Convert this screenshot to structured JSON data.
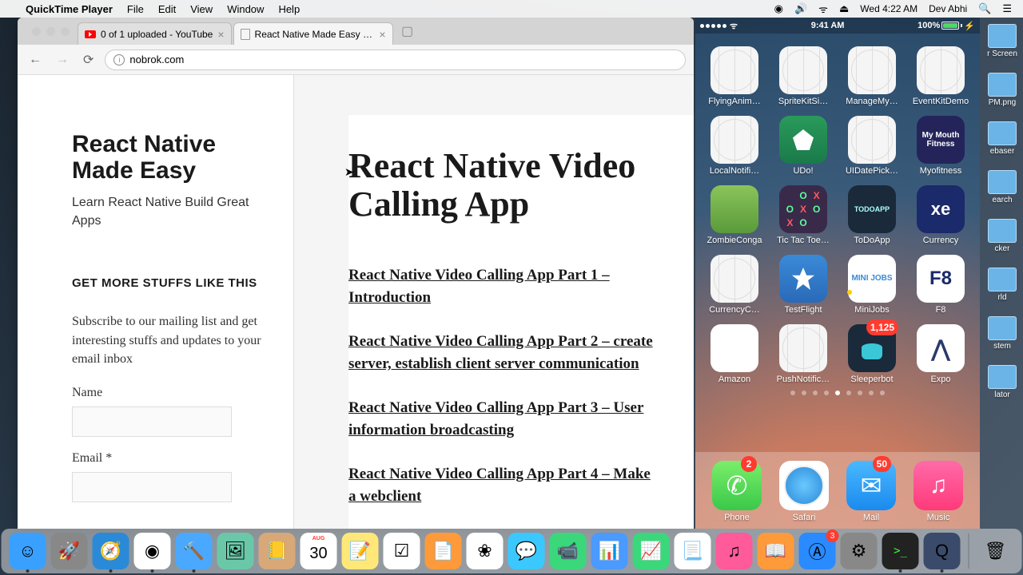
{
  "menubar": {
    "app_name": "QuickTime Player",
    "menus": [
      "File",
      "Edit",
      "View",
      "Window",
      "Help"
    ],
    "clock": "Wed 4:22 AM",
    "user": "Dev Abhi"
  },
  "browser": {
    "tabs": [
      {
        "title": "0 of 1 uploaded - YouTube",
        "active": false
      },
      {
        "title": "React Native Made Easy – Lea",
        "active": true
      }
    ],
    "url": "nobrok.com"
  },
  "page": {
    "site_title": "React Native Made Easy",
    "tagline": "Learn React Native Build Great Apps",
    "widget_title": "GET MORE STUFFS LIKE THIS",
    "widget_text": "Subscribe to our mailing list and get interesting stuffs and updates to your email inbox",
    "name_label": "Name",
    "email_label": "Email *",
    "article_title": "React Native Video Calling App",
    "links": [
      "React Native Video Calling App Part 1 – Introduction",
      "React Native Video Calling App Part 2 – create server, establish client server communication",
      "React Native Video Calling App Part 3 – User information broadcasting",
      "React Native Video Calling App Part 4 – Make a webclient"
    ]
  },
  "phone": {
    "time": "9:41 AM",
    "battery": "100%",
    "apps_rows": [
      [
        {
          "label": "FlyingAnim…",
          "style": "placeholder"
        },
        {
          "label": "SpriteKitSi…",
          "style": "placeholder"
        },
        {
          "label": "ManageMy…",
          "style": "placeholder"
        },
        {
          "label": "EventKitDemo",
          "style": "placeholder"
        }
      ],
      [
        {
          "label": "LocalNotifi…",
          "style": "placeholder"
        },
        {
          "label": "UDo!",
          "style": "ic-udo"
        },
        {
          "label": "UIDatePick…",
          "style": "placeholder"
        },
        {
          "label": "Myofitness",
          "style": "ic-myfit",
          "text": "My Mouth Fitness"
        }
      ],
      [
        {
          "label": "ZombieConga",
          "style": "ic-zombie"
        },
        {
          "label": "Tic Tac Toe…",
          "style": "ic-ttt"
        },
        {
          "label": "ToDoApp",
          "style": "ic-todo",
          "text": "TODOAPP"
        },
        {
          "label": "Currency",
          "style": "ic-xe",
          "text": "xe"
        }
      ],
      [
        {
          "label": "CurrencyC…",
          "style": "placeholder"
        },
        {
          "label": "TestFlight",
          "style": "ic-tf"
        },
        {
          "label": "MiniJobs",
          "style": "ic-mj",
          "text": "MINI JOBS",
          "dot": true
        },
        {
          "label": "F8",
          "style": "ic-f8",
          "text": "F8"
        }
      ],
      [
        {
          "label": "Amazon",
          "style": "ic-amz"
        },
        {
          "label": "PushNotific…",
          "style": "placeholder"
        },
        {
          "label": "Sleeperbot",
          "style": "ic-sleep",
          "badge": "1,125"
        },
        {
          "label": "Expo",
          "style": "ic-expo",
          "text": "⋀"
        }
      ]
    ],
    "dock": [
      {
        "label": "Phone",
        "style": "ic-phone",
        "glyph": "✆",
        "badge": "2"
      },
      {
        "label": "Safari",
        "style": "ic-safari"
      },
      {
        "label": "Mail",
        "style": "ic-mail",
        "glyph": "✉",
        "badge": "50"
      },
      {
        "label": "Music",
        "style": "ic-music",
        "glyph": "♫"
      }
    ]
  },
  "desktop_icons": [
    "r Screen",
    "PM.png",
    "ebaser",
    "earch",
    "cker",
    "rld",
    "stem",
    "lator"
  ],
  "dock": {
    "items": [
      {
        "name": "finder",
        "bg": "#3aa0ff",
        "glyph": "☺",
        "running": true
      },
      {
        "name": "launchpad",
        "bg": "#888",
        "glyph": "🚀"
      },
      {
        "name": "safari",
        "bg": "#2a8ad8",
        "glyph": "🧭",
        "running": true
      },
      {
        "name": "chrome",
        "bg": "#fff",
        "glyph": "◉",
        "running": true
      },
      {
        "name": "xcode",
        "bg": "#4aa8ff",
        "glyph": "🔨",
        "running": true
      },
      {
        "name": "preview",
        "bg": "#6ac8a8",
        "glyph": "🖼"
      },
      {
        "name": "contacts",
        "bg": "#d8a878",
        "glyph": "📒"
      },
      {
        "name": "calendar",
        "bg": "#fff",
        "glyph": "30",
        "text": "AUG",
        "running": false
      },
      {
        "name": "notes",
        "bg": "#ffe878",
        "glyph": "📝"
      },
      {
        "name": "reminders",
        "bg": "#fff",
        "glyph": "☑"
      },
      {
        "name": "pages",
        "bg": "#ff9a3a",
        "glyph": "📄"
      },
      {
        "name": "photos",
        "bg": "#fff",
        "glyph": "❀"
      },
      {
        "name": "messages",
        "bg": "#3ac8ff",
        "glyph": "💬"
      },
      {
        "name": "facetime",
        "bg": "#3ad87a",
        "glyph": "📹"
      },
      {
        "name": "keynote",
        "bg": "#4a9aff",
        "glyph": "📊"
      },
      {
        "name": "numbers",
        "bg": "#3ad87a",
        "glyph": "📈"
      },
      {
        "name": "textedit",
        "bg": "#fff",
        "glyph": "📃"
      },
      {
        "name": "itunes",
        "bg": "#ff5a9a",
        "glyph": "♫"
      },
      {
        "name": "ibooks",
        "bg": "#ff9a3a",
        "glyph": "📖"
      },
      {
        "name": "appstore",
        "bg": "#2a8aff",
        "glyph": "Ⓐ",
        "badge": "3"
      },
      {
        "name": "sysprefs",
        "bg": "#888",
        "glyph": "⚙"
      },
      {
        "name": "terminal",
        "bg": "#222",
        "glyph": ">_",
        "running": true
      },
      {
        "name": "quicktime",
        "bg": "#3a4a6a",
        "glyph": "Q",
        "running": true
      }
    ],
    "trash": {
      "name": "trash",
      "glyph": "🗑"
    }
  }
}
